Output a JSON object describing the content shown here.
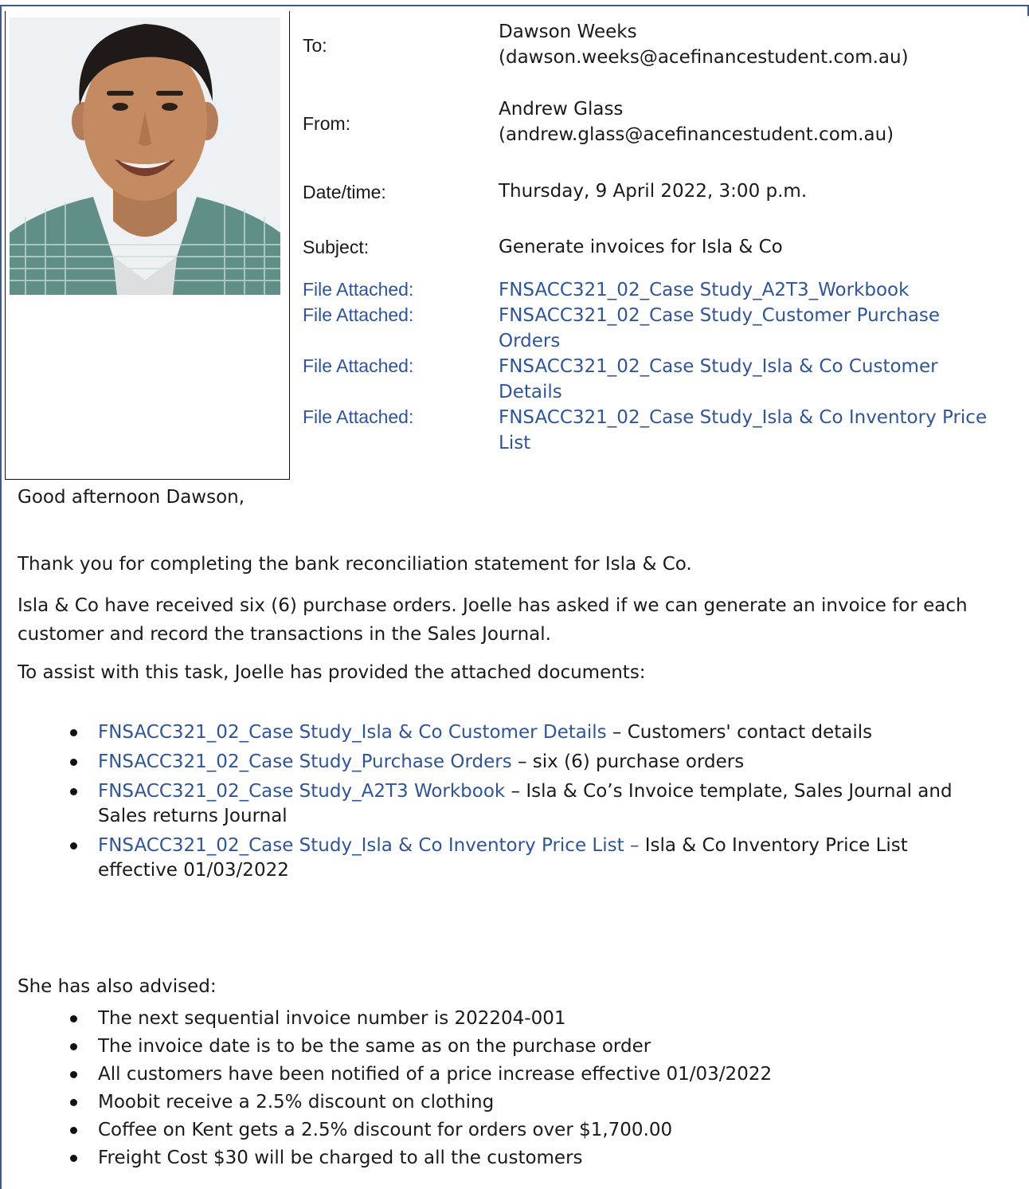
{
  "header": {
    "to_label": "To:",
    "to_value": "Dawson Weeks\n(dawson.weeks@acefinancestudent.com.au)",
    "to_name": "Dawson Weeks",
    "to_email": "(dawson.weeks@acefinancestudent.com.au)",
    "from_label": "From:",
    "from_name": "Andrew Glass",
    "from_email": "(andrew.glass@acefinancestudent.com.au)",
    "date_label": "Date/time:",
    "date_value": "Thursday, 9 April 2022, 3:00 p.m.",
    "subject_label": "Subject:",
    "subject_value": "Generate invoices for Isla & Co"
  },
  "attachments": [
    {
      "label": "File Attached:",
      "name": "FNSACC321_02_Case Study_A2T3_Workbook"
    },
    {
      "label": "File Attached:",
      "name": "FNSACC321_02_Case Study_Customer Purchase Orders"
    },
    {
      "label": "File Attached:",
      "name": "FNSACC321_02_Case Study_Isla & Co Customer Details"
    },
    {
      "label": "File Attached:",
      "name": "FNSACC321_02_Case Study_Isla & Co Inventory Price List"
    }
  ],
  "body": {
    "greeting": "Good afternoon Dawson,",
    "p1": "Thank you for completing the bank reconciliation statement for Isla & Co.",
    "p2": "Isla & Co have received six (6) purchase orders. Joelle has asked if we can generate an invoice for each customer and record the transactions in the Sales Journal.",
    "p3": "To assist with this task, Joelle has provided the attached documents:",
    "docs": [
      {
        "link": "FNSACC321_02_Case Study_Isla & Co Customer Details",
        "text": " – Customers' contact details"
      },
      {
        "link": "FNSACC321_02_Case Study_Purchase Orders",
        "text": " – six (6) purchase orders"
      },
      {
        "link": "FNSACC321_02_Case Study_A2T3 Workbook",
        "text": " – Isla & Co’s Invoice template, Sales Journal and Sales returns Journal"
      },
      {
        "link": "FNSACC321_02_Case Study_Isla & Co Inventory Price List –",
        "text": " Isla & Co Inventory Price List effective 01/03/2022"
      }
    ],
    "p4": "She has also advised:",
    "advised": [
      "The next sequential invoice number is 202204-001",
      "The invoice date is to be the same as on the purchase order",
      "All customers have been notified of a price increase effective 01/03/2022",
      "Moobit receive a 2.5% discount on clothing",
      "Coffee on Kent gets a 2.5% discount for orders over $1,700.00",
      "Freight Cost $30 will be charged to all the customers"
    ]
  },
  "colors": {
    "link": "#2f5597",
    "frame": "#3b5b8c",
    "text": "#1a1a1a"
  }
}
